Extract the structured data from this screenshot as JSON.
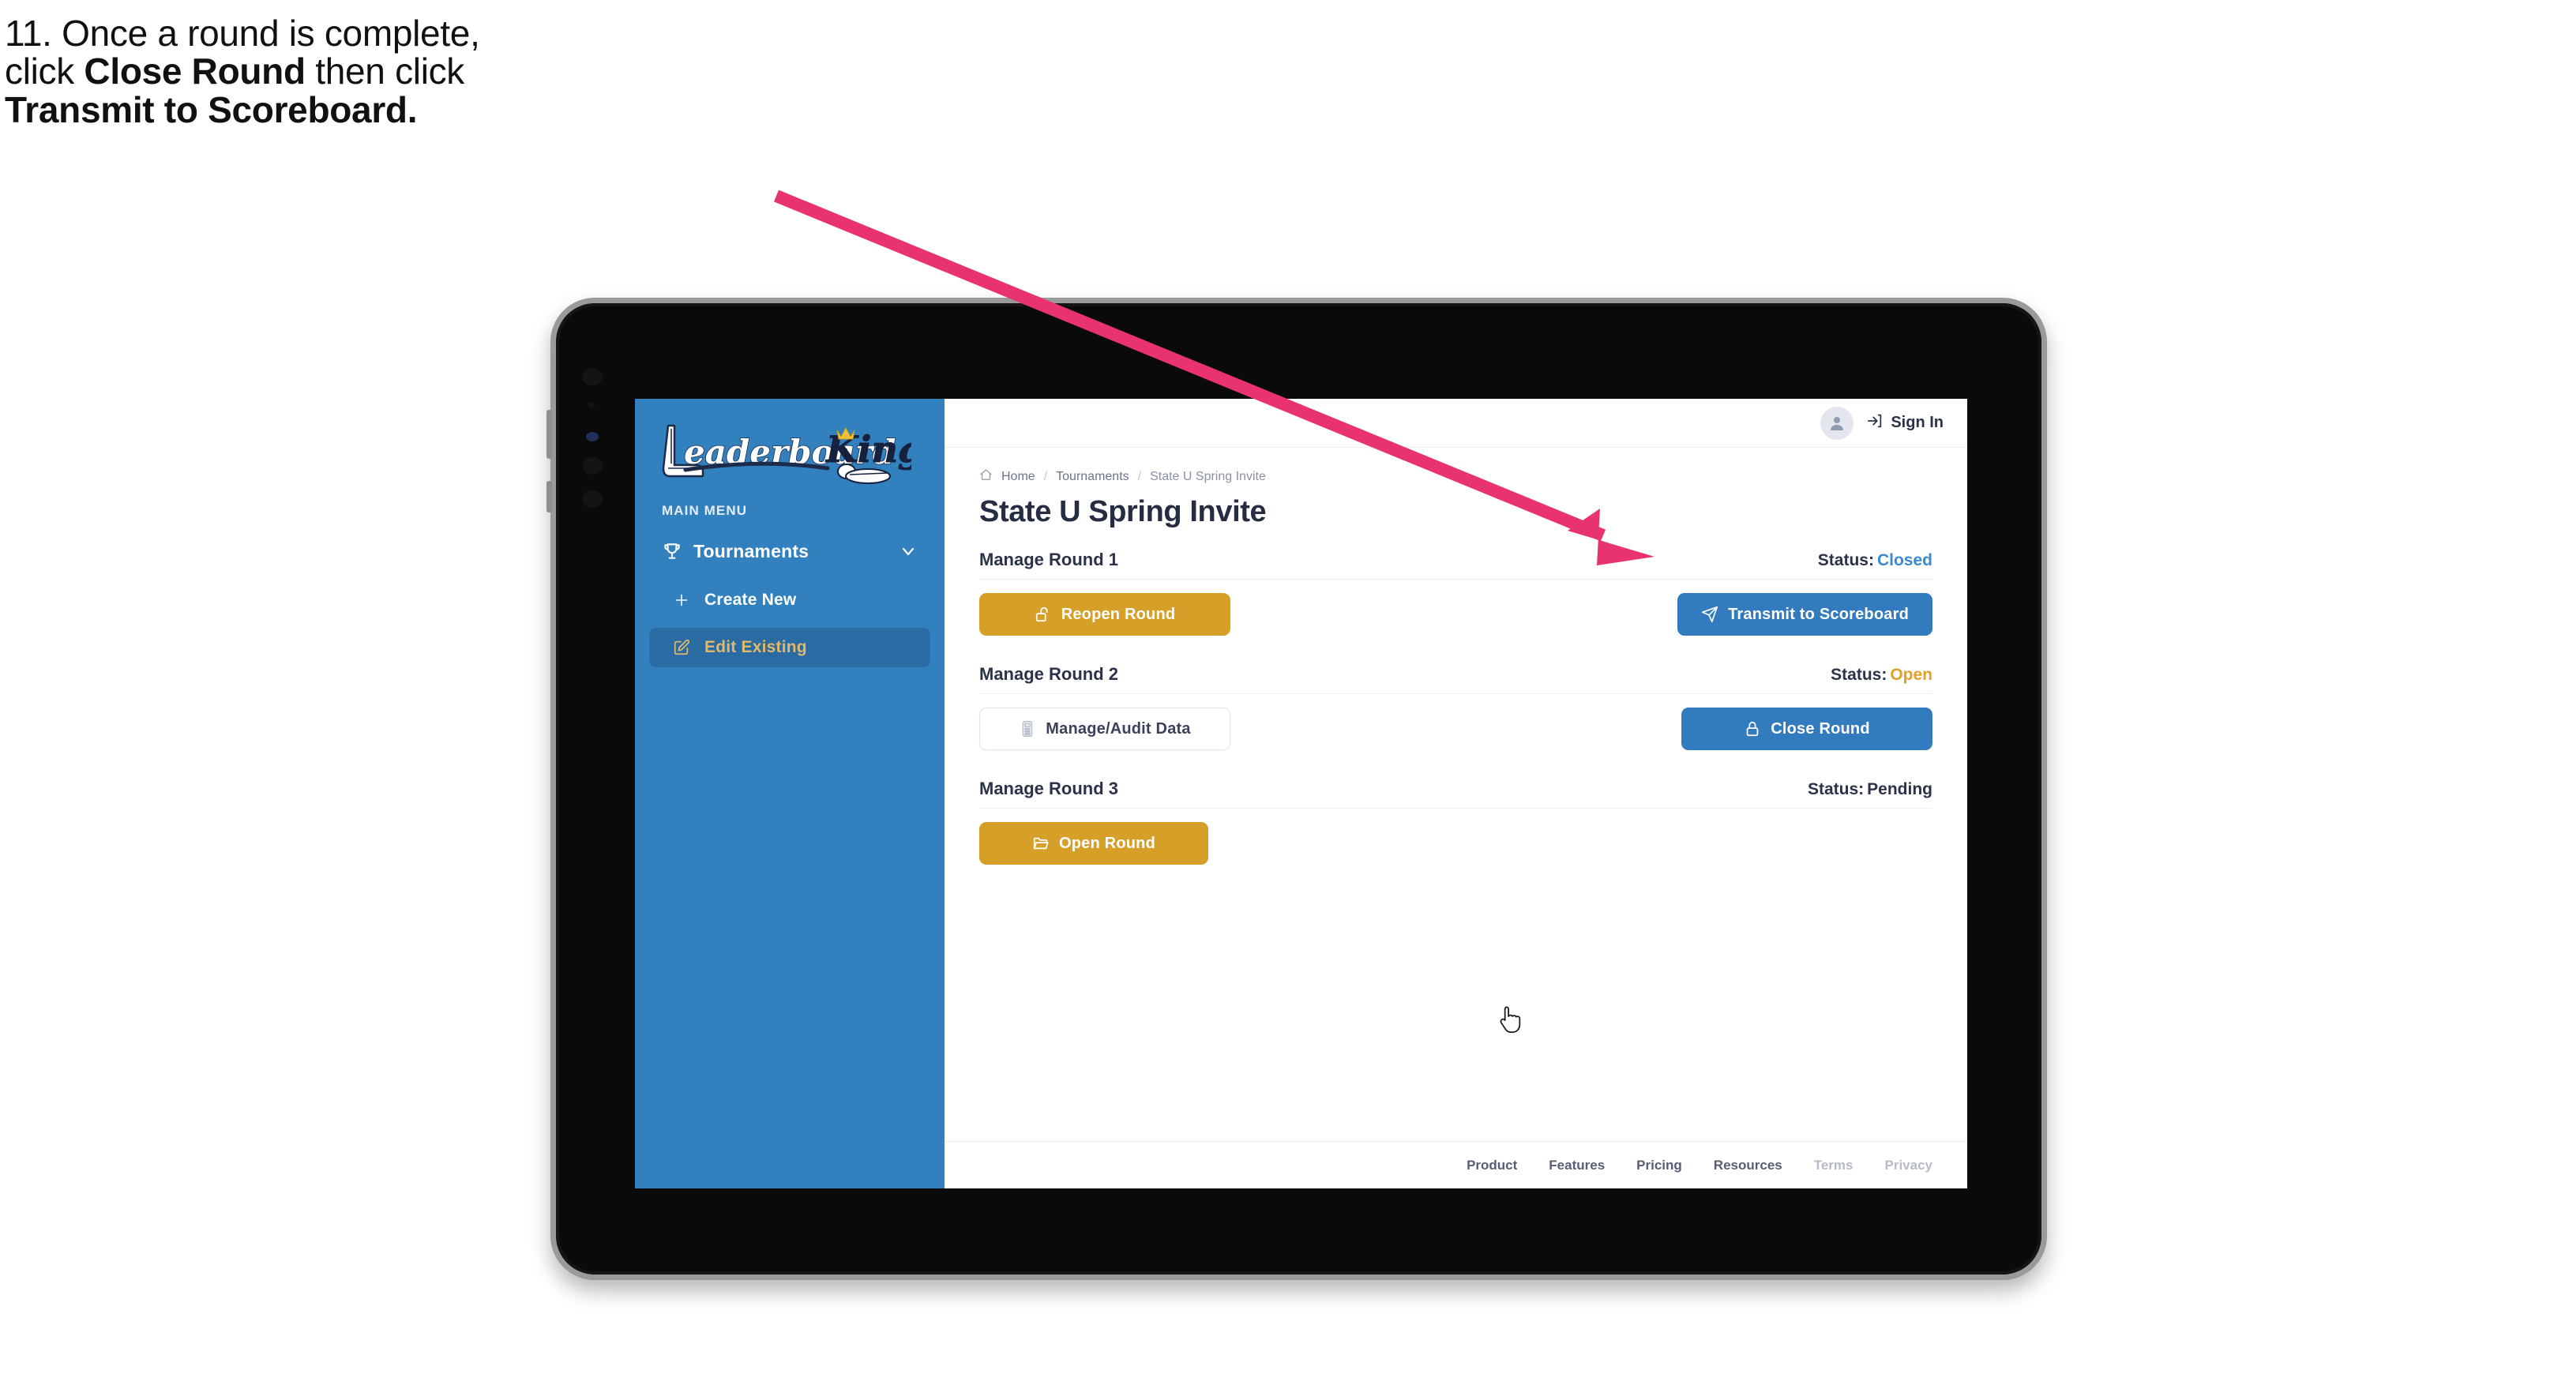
{
  "caption": {
    "line1": "11. Once a round is complete,",
    "line2_pre": "click ",
    "line2_bold": "Close Round",
    "line2_post": " then click",
    "line3_bold": "Transmit to Scoreboard."
  },
  "annotation": {
    "arrow_color": "#E8336E",
    "arrow_from": "983,248",
    "arrow_to": "2095,705"
  },
  "sidebar": {
    "logo_text_primary": "Leaderboard",
    "logo_text_secondary": "King",
    "menu_label": "MAIN MENU",
    "items": [
      {
        "label": "Tournaments",
        "icon": "trophy-icon",
        "chevron": "chevron-down-icon",
        "active": false
      },
      {
        "label": "Create New",
        "icon": "plus-icon",
        "active": false
      },
      {
        "label": "Edit Existing",
        "icon": "edit-pencil-icon",
        "active": true
      }
    ],
    "bg_color": "#3280BE",
    "active_bg_color": "#2A6BA3",
    "active_text_color": "#E0B96A"
  },
  "topbar": {
    "avatar_icon": "user-avatar-icon",
    "signin_icon": "sign-in-arrow-icon",
    "signin_label": "Sign In"
  },
  "breadcrumb": {
    "home_icon": "home-icon",
    "items": [
      "Home",
      "Tournaments",
      "State U Spring Invite"
    ],
    "separator": "/"
  },
  "page": {
    "title": "State U Spring Invite"
  },
  "rounds": [
    {
      "name": "Manage Round 1",
      "status_label": "Status:",
      "status_value": "Closed",
      "status_class": "st-closed",
      "left_button": {
        "label": "Reopen Round",
        "icon": "unlock-icon",
        "style": "btn-gold"
      },
      "right_button": {
        "label": "Transmit to Scoreboard",
        "icon": "paper-plane-icon",
        "style": "btn-blue"
      }
    },
    {
      "name": "Manage Round 2",
      "status_label": "Status:",
      "status_value": "Open",
      "status_class": "st-open",
      "left_button": {
        "label": "Manage/Audit Data",
        "icon": "calculator-icon",
        "style": "btn-ghost"
      },
      "right_button": {
        "label": "Close Round",
        "icon": "lock-icon",
        "style": "btn-blue"
      }
    },
    {
      "name": "Manage Round 3",
      "status_label": "Status:",
      "status_value": "Pending",
      "status_class": "st-pending",
      "left_button": {
        "label": "Open Round",
        "icon": "folder-open-icon",
        "style": "btn-gold"
      },
      "right_button": null
    }
  ],
  "footer": {
    "links": [
      {
        "label": "Product",
        "muted": false
      },
      {
        "label": "Features",
        "muted": false
      },
      {
        "label": "Pricing",
        "muted": false
      },
      {
        "label": "Resources",
        "muted": false
      },
      {
        "label": "Terms",
        "muted": true
      },
      {
        "label": "Privacy",
        "muted": true
      }
    ]
  },
  "cursor": {
    "type": "pointing-hand-cursor"
  },
  "colors": {
    "brand_blue": "#3280BE",
    "button_blue": "#327BBE",
    "button_gold": "#D6A028",
    "status_closed": "#3E88D0",
    "status_open": "#E0A02A",
    "text_dark": "#2B3249"
  }
}
